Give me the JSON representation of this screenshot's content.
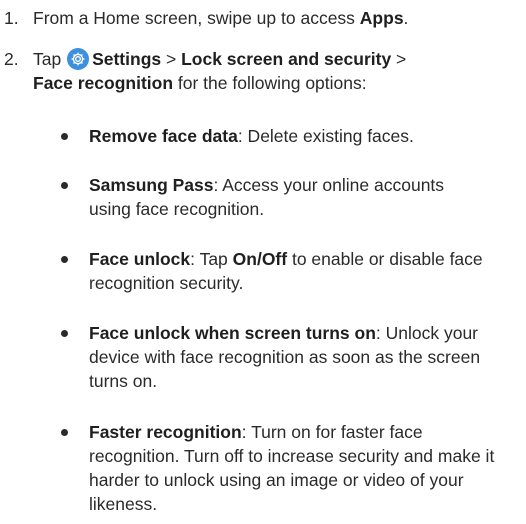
{
  "steps": [
    {
      "number": "1.",
      "pre": "From a Home screen, swipe up to access ",
      "bold": "Apps",
      "post": "."
    },
    {
      "number": "2.",
      "tap": "Tap ",
      "settings": "Settings",
      "sep1": " > ",
      "lock": "Lock screen and security",
      "sep2": " >",
      "face": "Face recognition",
      "rest": " for the following options:"
    }
  ],
  "options": [
    {
      "title": "Remove face data",
      "desc": ": Delete existing faces."
    },
    {
      "title": "Samsung Pass",
      "desc": ": Access your online accounts using face recognition."
    },
    {
      "title": "Face unlock",
      "desc_pre": ": Tap ",
      "desc_bold": "On/Off",
      "desc_post": " to enable or disable face recognition security."
    },
    {
      "title": "Face unlock when screen turns on",
      "desc": ": Unlock your device with face recognition as soon as the screen turns on."
    },
    {
      "title": "Faster recognition",
      "desc": ": Turn on for faster face recognition. Turn off to increase security and make it harder to unlock using an image or video of your likeness."
    }
  ],
  "icons": {
    "settings": "settings-gear-icon"
  },
  "colors": {
    "gear": "#3d8fe0",
    "text": "#2a2a2a"
  }
}
